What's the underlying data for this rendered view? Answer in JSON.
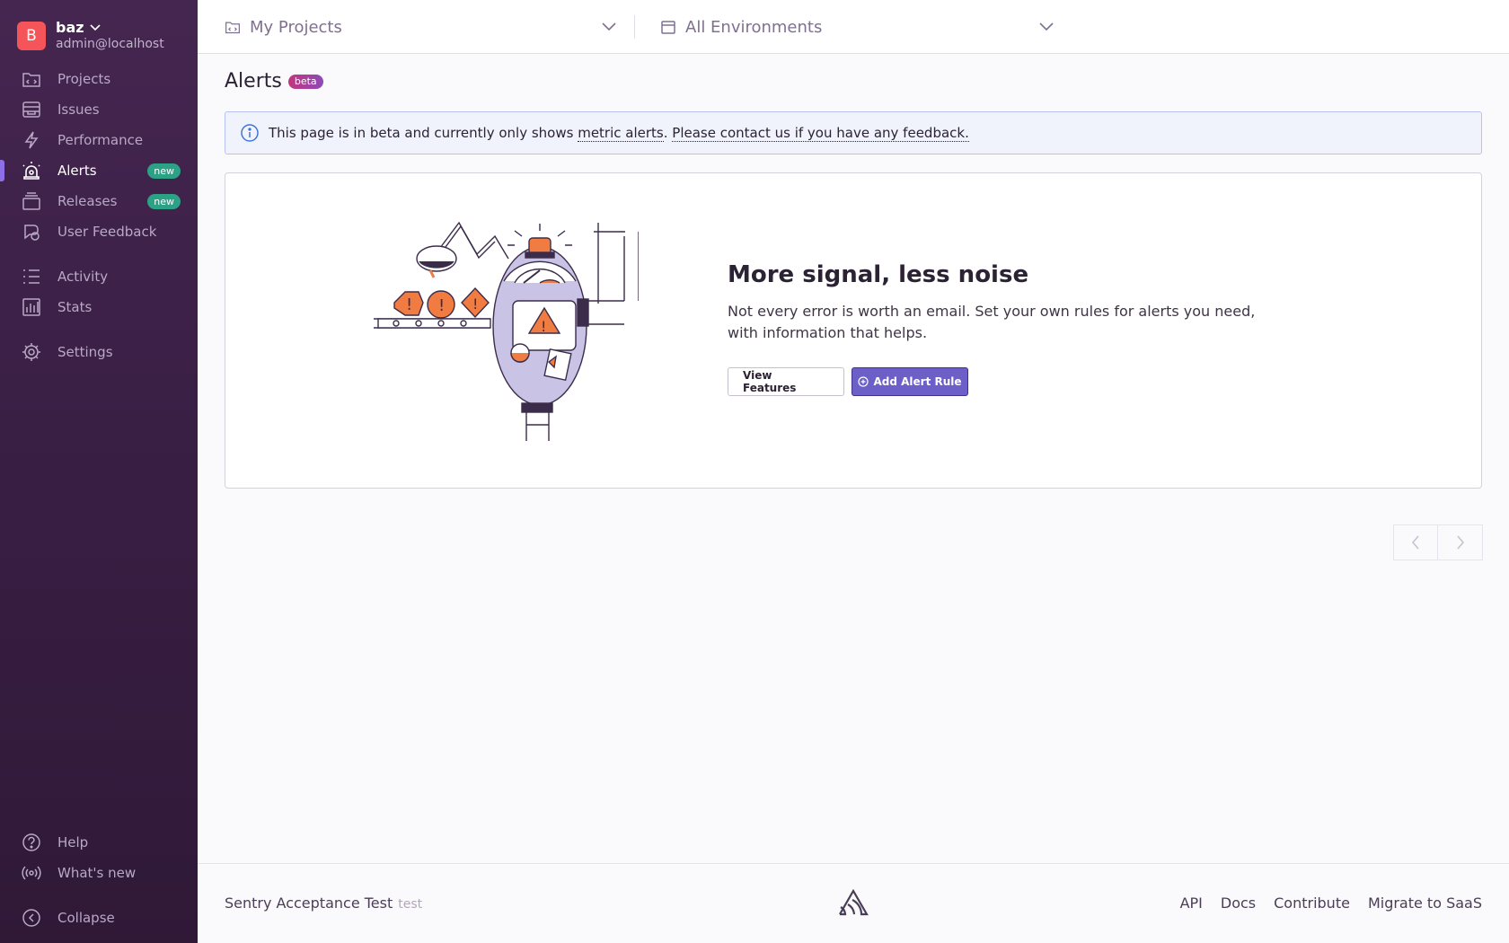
{
  "org": {
    "initial": "B",
    "name": "baz",
    "user": "admin@localhost"
  },
  "sidebar": {
    "items": [
      {
        "label": "Projects",
        "icon": "projects-icon"
      },
      {
        "label": "Issues",
        "icon": "issues-icon"
      },
      {
        "label": "Performance",
        "icon": "performance-icon"
      },
      {
        "label": "Alerts",
        "icon": "alerts-icon",
        "badge": "new",
        "active": true
      },
      {
        "label": "Releases",
        "icon": "releases-icon",
        "badge": "new"
      },
      {
        "label": "User Feedback",
        "icon": "user-feedback-icon"
      },
      {
        "label": "Activity",
        "icon": "activity-icon"
      },
      {
        "label": "Stats",
        "icon": "stats-icon"
      },
      {
        "label": "Settings",
        "icon": "settings-icon"
      }
    ],
    "bottom": [
      {
        "label": "Help",
        "icon": "help-icon"
      },
      {
        "label": "What's new",
        "icon": "broadcast-icon"
      },
      {
        "label": "Collapse",
        "icon": "collapse-icon"
      }
    ]
  },
  "header": {
    "projects": "My Projects",
    "environments": "All Environments"
  },
  "page": {
    "title": "Alerts",
    "badge": "beta"
  },
  "alert": {
    "text_before": "This page is in beta and currently only shows ",
    "link1": "metric alerts",
    "sep": ". ",
    "link2": "Please contact us if you have any feedback."
  },
  "empty_state": {
    "heading": "More signal, less noise",
    "body": "Not every error is worth an email. Set your own rules for alerts you need, with information that helps.",
    "view_features": "View Features",
    "add_rule": "Add Alert Rule"
  },
  "footer": {
    "org": "Sentry Acceptance Test",
    "tag": "test",
    "links": [
      "API",
      "Docs",
      "Contribute",
      "Migrate to SaaS"
    ]
  },
  "colors": {
    "sidebar": "#452650",
    "accent": "#6c5fc7",
    "badge_new": "#2ba185",
    "avatar": "#f55459"
  }
}
